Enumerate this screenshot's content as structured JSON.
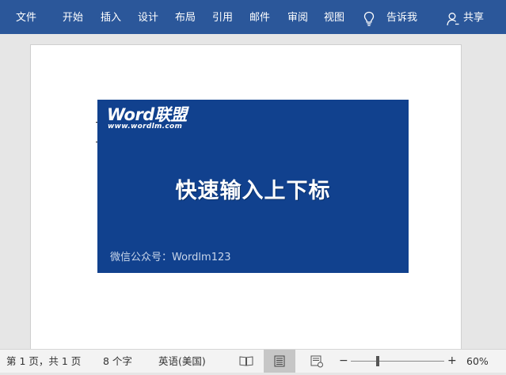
{
  "ribbon": {
    "tabs": [
      "文件",
      "开始",
      "插入",
      "设计",
      "布局",
      "引用",
      "邮件",
      "审阅",
      "视图"
    ],
    "tell_me": "告诉我",
    "share": "共享"
  },
  "banner": {
    "logo_word": "Word联盟",
    "logo_url": "www.wordlm.com",
    "title": "快速输入上下标",
    "footer": "微信公众号：Wordlm123"
  },
  "status": {
    "page": "第 1 页，共 1 页",
    "words": "8 个字",
    "language": "英语(美国)",
    "zoom_minus": "−",
    "zoom_plus": "+",
    "zoom_percent": "60%",
    "zoom_level": 60,
    "active_view": "print-layout"
  },
  "colors": {
    "ribbon": "#2b579a",
    "banner": "#11418e"
  }
}
